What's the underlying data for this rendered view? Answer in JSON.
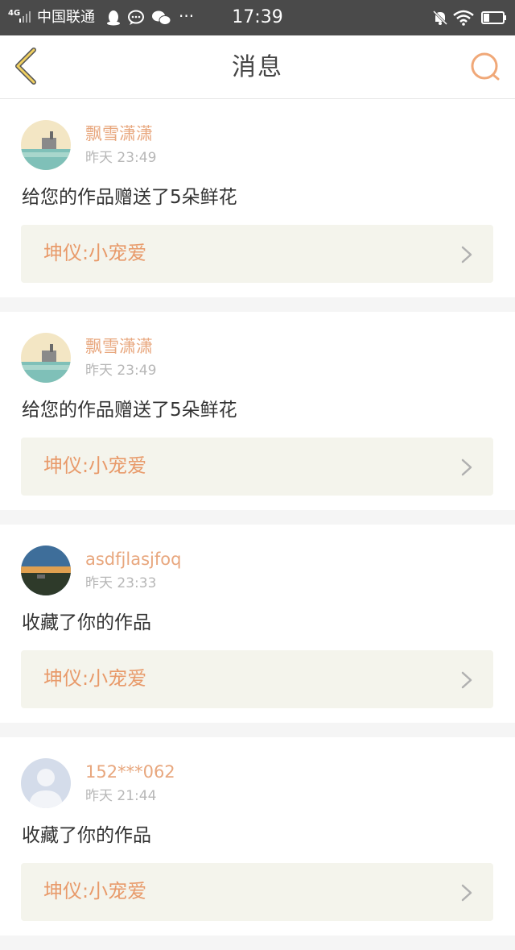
{
  "status_bar": {
    "network": "4G",
    "carrier": "中国联通",
    "dots": "···",
    "time": "17:39"
  },
  "header": {
    "title": "消息",
    "back_icon": "chevron-left-icon",
    "search_icon": "search-icon"
  },
  "colors": {
    "accent": "#e8a77e",
    "link_bg": "#f4f4ec",
    "back_arrow": "#f0d060"
  },
  "messages": [
    {
      "username": "飘雪潇潇",
      "time": "昨天 23:49",
      "text": "给您的作品赠送了5朵鲜花",
      "work_title": "坤仪:小宠爱"
    },
    {
      "username": "飘雪潇潇",
      "time": "昨天 23:49",
      "text": "给您的作品赠送了5朵鲜花",
      "work_title": "坤仪:小宠爱"
    },
    {
      "username": "asdfjlasjfoq",
      "time": "昨天 23:33",
      "text": "收藏了你的作品",
      "work_title": "坤仪:小宠爱"
    },
    {
      "username": "152***062",
      "time": "昨天 21:44",
      "text": "收藏了你的作品",
      "work_title": "坤仪:小宠爱"
    }
  ]
}
